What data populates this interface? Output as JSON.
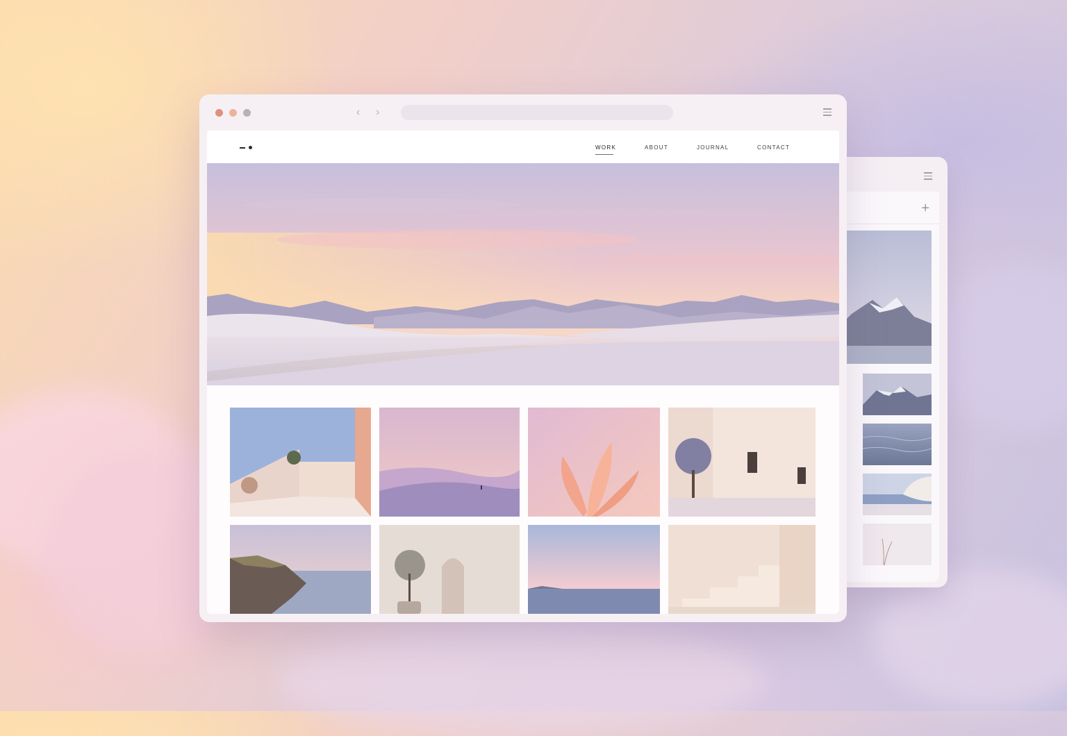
{
  "site": {
    "nav": [
      {
        "label": "WORK",
        "active": true
      },
      {
        "label": "ABOUT",
        "active": false
      },
      {
        "label": "JOURNAL",
        "active": false
      },
      {
        "label": "CONTACT",
        "active": false
      }
    ]
  },
  "icons": {
    "back": "chevron-left-icon",
    "forward": "chevron-right-icon",
    "menu": "hamburger-menu-icon",
    "add": "plus-icon"
  },
  "colors": {
    "traffic_close": "#e0917c",
    "traffic_minimize": "#ecb39c",
    "traffic_zoom": "#b8b2b8",
    "active_nav": "#1e1d22"
  }
}
